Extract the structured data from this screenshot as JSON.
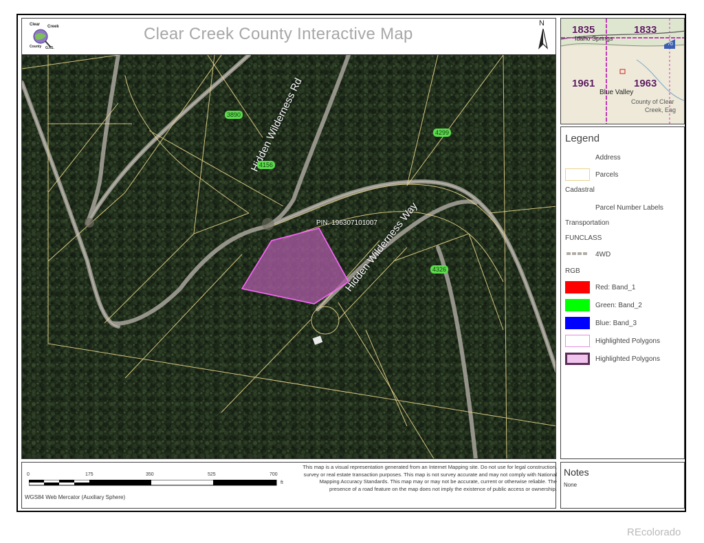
{
  "header": {
    "title": "Clear Creek County Interactive Map",
    "logo_lines": [
      "Clear",
      "Creek",
      "County",
      "G.I.S."
    ],
    "north_label": "N"
  },
  "map": {
    "road_labels": [
      "Hidden Wilderness Rd",
      "Hidden Wilderness Way"
    ],
    "pin_label": "PIN: 196307101007",
    "address_labels": [
      "3890",
      "4156",
      "4299",
      "4326"
    ]
  },
  "overview": {
    "section_labels": [
      "1835",
      "1833",
      "1961",
      "1963"
    ],
    "place_labels": [
      "Idaho Springs",
      "Blue Valley",
      "County of Clear",
      "Creek, Eag"
    ],
    "highway_shield": "70"
  },
  "legend": {
    "title": "Legend",
    "rows": [
      {
        "label": "Address"
      },
      {
        "label": "Parcels"
      },
      {
        "label": "Cadastral"
      },
      {
        "label": "Parcel Number Labels"
      },
      {
        "label": "Transportation"
      },
      {
        "label": "FUNCLASS"
      },
      {
        "label": "4WD"
      },
      {
        "label": "RGB"
      },
      {
        "label": "Red:  Band_1"
      },
      {
        "label": "Green: Band_2"
      },
      {
        "label": "Blue:  Band_3"
      },
      {
        "label": "Highlighted Polygons"
      },
      {
        "label": "Highlighted Polygons"
      }
    ]
  },
  "scale": {
    "ticks": [
      "0",
      "175",
      "350",
      "525",
      "700"
    ],
    "unit": "ft",
    "projection": "WGS84 Web Mercator (Auxiliary Sphere)"
  },
  "disclaimer": "This map is a visual representation generated from an Internet Mapping site. Do not use for legal construction, survey or real estate transaction purposes. This map is not survey accurate and may not comply with National Mapping Accuracy Standards. This map may or may not be accurate, current or otherwise reliable. The presence of a road feature on the map does not imply the existence of public access or ownership.",
  "notes": {
    "title": "Notes",
    "value": "None"
  },
  "watermark": "REcolorado",
  "colors": {
    "parcel_line": "#e8d48a",
    "highlight_fill": "#a4589e",
    "highlight_stroke": "#ff66ff",
    "address_label_bg": "#5bdc4c",
    "forest_dark": "#1a2716",
    "road_gray": "#a8a6a2",
    "legend_red": "#ff0000",
    "legend_green": "#00ff00",
    "legend_blue": "#0000ff"
  }
}
